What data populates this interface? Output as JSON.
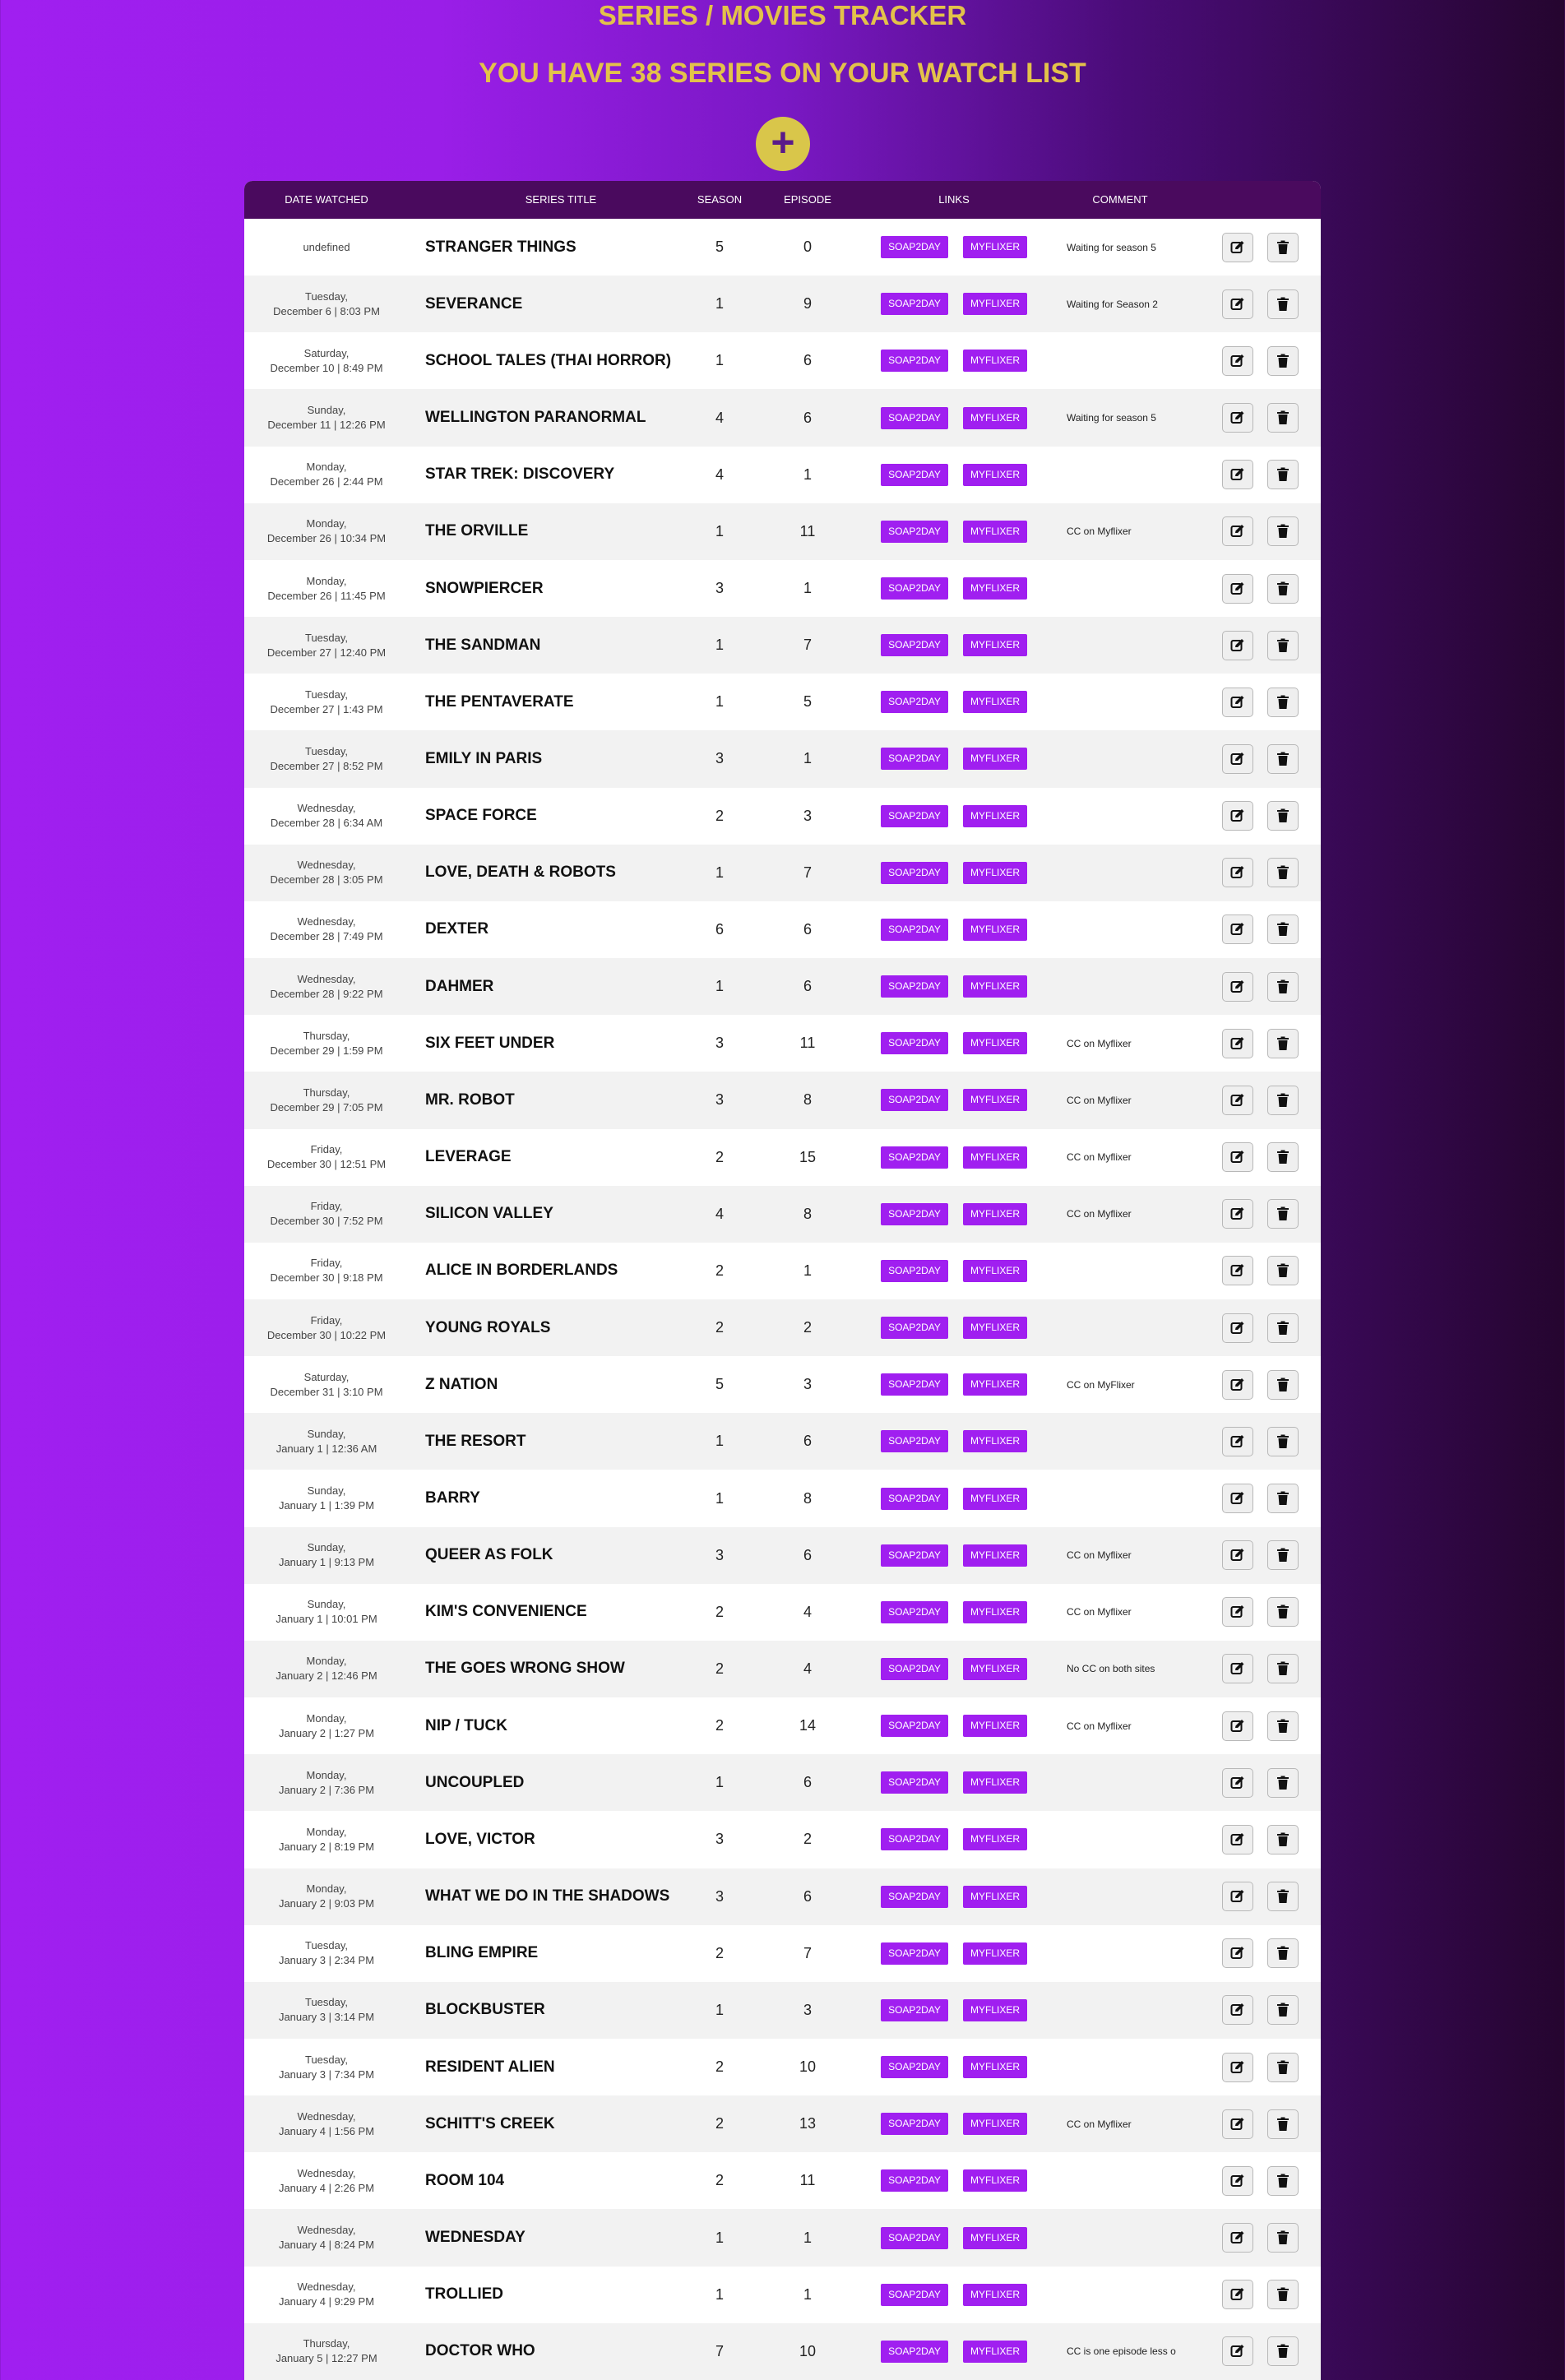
{
  "header": {
    "title": "SERIES / MOVIES TRACKER",
    "subtitle": "YOU HAVE 38 SERIES ON YOUR WATCH LIST",
    "add_label": "+"
  },
  "columns": [
    "DATE WATCHED",
    "SERIES TITLE",
    "SEASON",
    "EPISODE",
    "LINKS",
    "COMMENT"
  ],
  "link_labels": {
    "soap": "SOAP2DAY",
    "my": "MYFLIXER"
  },
  "icons": {
    "edit": "edit-icon",
    "delete": "trash-icon"
  },
  "rows": [
    {
      "d1": "undefined",
      "d2": "",
      "title": "STRANGER THINGS",
      "season": "5",
      "episode": "0",
      "comment": "Waiting for season 5"
    },
    {
      "d1": "Tuesday,",
      "d2": "December 6 | 8:03 PM",
      "title": "SEVERANCE",
      "season": "1",
      "episode": "9",
      "comment": "Waiting for Season 2"
    },
    {
      "d1": "Saturday,",
      "d2": "December 10 | 8:49 PM",
      "title": "SCHOOL TALES (THAI HORROR)",
      "season": "1",
      "episode": "6",
      "comment": ""
    },
    {
      "d1": "Sunday,",
      "d2": "December 11 | 12:26 PM",
      "title": "WELLINGTON PARANORMAL",
      "season": "4",
      "episode": "6",
      "comment": "Waiting for season 5"
    },
    {
      "d1": "Monday,",
      "d2": "December 26 | 2:44 PM",
      "title": "STAR TREK: DISCOVERY",
      "season": "4",
      "episode": "1",
      "comment": ""
    },
    {
      "d1": "Monday,",
      "d2": "December 26 | 10:34 PM",
      "title": "THE ORVILLE",
      "season": "1",
      "episode": "11",
      "comment": "CC on Myflixer"
    },
    {
      "d1": "Monday,",
      "d2": "December 26 | 11:45 PM",
      "title": "SNOWPIERCER",
      "season": "3",
      "episode": "1",
      "comment": ""
    },
    {
      "d1": "Tuesday,",
      "d2": "December 27 | 12:40 PM",
      "title": "THE SANDMAN",
      "season": "1",
      "episode": "7",
      "comment": ""
    },
    {
      "d1": "Tuesday,",
      "d2": "December 27 | 1:43 PM",
      "title": "THE PENTAVERATE",
      "season": "1",
      "episode": "5",
      "comment": ""
    },
    {
      "d1": "Tuesday,",
      "d2": "December 27 | 8:52 PM",
      "title": "EMILY IN PARIS",
      "season": "3",
      "episode": "1",
      "comment": ""
    },
    {
      "d1": "Wednesday,",
      "d2": "December 28 | 6:34 AM",
      "title": "SPACE FORCE",
      "season": "2",
      "episode": "3",
      "comment": ""
    },
    {
      "d1": "Wednesday,",
      "d2": "December 28 | 3:05 PM",
      "title": "LOVE, DEATH & ROBOTS",
      "season": "1",
      "episode": "7",
      "comment": ""
    },
    {
      "d1": "Wednesday,",
      "d2": "December 28 | 7:49 PM",
      "title": "DEXTER",
      "season": "6",
      "episode": "6",
      "comment": ""
    },
    {
      "d1": "Wednesday,",
      "d2": "December 28 | 9:22 PM",
      "title": "DAHMER",
      "season": "1",
      "episode": "6",
      "comment": ""
    },
    {
      "d1": "Thursday,",
      "d2": "December 29 | 1:59 PM",
      "title": "SIX FEET UNDER",
      "season": "3",
      "episode": "11",
      "comment": "CC on Myflixer"
    },
    {
      "d1": "Thursday,",
      "d2": "December 29 | 7:05 PM",
      "title": "MR. ROBOT",
      "season": "3",
      "episode": "8",
      "comment": "CC on Myflixer"
    },
    {
      "d1": "Friday,",
      "d2": "December 30 | 12:51 PM",
      "title": "LEVERAGE",
      "season": "2",
      "episode": "15",
      "comment": "CC on Myflixer"
    },
    {
      "d1": "Friday,",
      "d2": "December 30 | 7:52 PM",
      "title": "SILICON VALLEY",
      "season": "4",
      "episode": "8",
      "comment": "CC on Myflixer"
    },
    {
      "d1": "Friday,",
      "d2": "December 30 | 9:18 PM",
      "title": "ALICE IN BORDERLANDS",
      "season": "2",
      "episode": "1",
      "comment": ""
    },
    {
      "d1": "Friday,",
      "d2": "December 30 | 10:22 PM",
      "title": "YOUNG ROYALS",
      "season": "2",
      "episode": "2",
      "comment": ""
    },
    {
      "d1": "Saturday,",
      "d2": "December 31 | 3:10 PM",
      "title": "Z NATION",
      "season": "5",
      "episode": "3",
      "comment": "CC on MyFlixer"
    },
    {
      "d1": "Sunday,",
      "d2": "January 1 | 12:36 AM",
      "title": "THE RESORT",
      "season": "1",
      "episode": "6",
      "comment": ""
    },
    {
      "d1": "Sunday,",
      "d2": "January 1 | 1:39 PM",
      "title": "BARRY",
      "season": "1",
      "episode": "8",
      "comment": ""
    },
    {
      "d1": "Sunday,",
      "d2": "January 1 | 9:13 PM",
      "title": "QUEER AS FOLK",
      "season": "3",
      "episode": "6",
      "comment": "CC on Myflixer"
    },
    {
      "d1": "Sunday,",
      "d2": "January 1 | 10:01 PM",
      "title": "KIM'S CONVENIENCE",
      "season": "2",
      "episode": "4",
      "comment": "CC on Myflixer"
    },
    {
      "d1": "Monday,",
      "d2": "January 2 | 12:46 PM",
      "title": "THE GOES WRONG SHOW",
      "season": "2",
      "episode": "4",
      "comment": "No CC on both sites"
    },
    {
      "d1": "Monday,",
      "d2": "January 2 | 1:27 PM",
      "title": "NIP / TUCK",
      "season": "2",
      "episode": "14",
      "comment": "CC on Myflixer"
    },
    {
      "d1": "Monday,",
      "d2": "January 2 | 7:36 PM",
      "title": "UNCOUPLED",
      "season": "1",
      "episode": "6",
      "comment": ""
    },
    {
      "d1": "Monday,",
      "d2": "January 2 | 8:19 PM",
      "title": "LOVE, VICTOR",
      "season": "3",
      "episode": "2",
      "comment": ""
    },
    {
      "d1": "Monday,",
      "d2": "January 2 | 9:03 PM",
      "title": "WHAT WE DO IN THE SHADOWS",
      "season": "3",
      "episode": "6",
      "comment": ""
    },
    {
      "d1": "Tuesday,",
      "d2": "January 3 | 2:34 PM",
      "title": "BLING EMPIRE",
      "season": "2",
      "episode": "7",
      "comment": ""
    },
    {
      "d1": "Tuesday,",
      "d2": "January 3 | 3:14 PM",
      "title": "BLOCKBUSTER",
      "season": "1",
      "episode": "3",
      "comment": ""
    },
    {
      "d1": "Tuesday,",
      "d2": "January 3 | 7:34 PM",
      "title": "RESIDENT ALIEN",
      "season": "2",
      "episode": "10",
      "comment": ""
    },
    {
      "d1": "Wednesday,",
      "d2": "January 4 | 1:56 PM",
      "title": "SCHITT'S CREEK",
      "season": "2",
      "episode": "13",
      "comment": "CC on Myflixer"
    },
    {
      "d1": "Wednesday,",
      "d2": "January 4 | 2:26 PM",
      "title": "ROOM 104",
      "season": "2",
      "episode": "11",
      "comment": ""
    },
    {
      "d1": "Wednesday,",
      "d2": "January 4 | 8:24 PM",
      "title": "WEDNESDAY",
      "season": "1",
      "episode": "1",
      "comment": ""
    },
    {
      "d1": "Wednesday,",
      "d2": "January 4 | 9:29 PM",
      "title": "TROLLIED",
      "season": "1",
      "episode": "1",
      "comment": ""
    },
    {
      "d1": "Thursday,",
      "d2": "January 5 | 12:27 PM",
      "title": "DOCTOR WHO",
      "season": "7",
      "episode": "10",
      "comment": "CC is one episode less o"
    }
  ]
}
